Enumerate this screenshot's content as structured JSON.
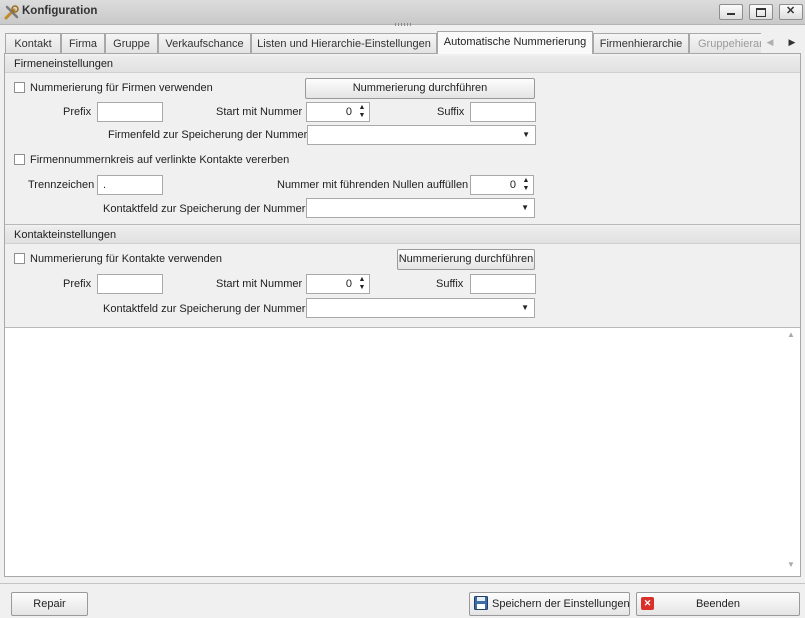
{
  "window": {
    "title": "Konfiguration"
  },
  "tabs": [
    {
      "label": "Kontakt"
    },
    {
      "label": "Firma"
    },
    {
      "label": "Gruppe"
    },
    {
      "label": "Verkaufschance"
    },
    {
      "label": "Listen und Hierarchie-Einstellungen"
    },
    {
      "label": "Automatische Nummerierung"
    },
    {
      "label": "Firmenhierarchie"
    },
    {
      "label": "Gruppehierar"
    }
  ],
  "active_tab": "Automatische Nummerierung",
  "firmen": {
    "header": "Firmeneinstellungen",
    "use_numbering_label": "Nummerierung für Firmen verwenden",
    "use_numbering_checked": false,
    "run_button": "Nummerierung durchführen",
    "prefix_label": "Prefix",
    "prefix_value": "",
    "start_label": "Start mit Nummer",
    "start_value": "0",
    "suffix_label": "Suffix",
    "suffix_value": "",
    "field_label": "Firmenfeld zur Speicherung der Nummer",
    "field_value": "",
    "inherit_label": "Firmennummernkreis auf verlinkte Kontakte vererben",
    "inherit_checked": false,
    "separator_label": "Trennzeichen",
    "separator_value": ".",
    "leading_zeros_label": "Nummer mit führenden Nullen auffüllen",
    "leading_zeros_value": "0",
    "contact_field_label": "Kontaktfeld zur Speicherung der Nummer",
    "contact_field_value": ""
  },
  "kontakte": {
    "header": "Kontakteinstellungen",
    "use_numbering_label": "Nummerierung für Kontakte verwenden",
    "use_numbering_checked": false,
    "run_button": "Nummerierung durchführen",
    "prefix_label": "Prefix",
    "prefix_value": "",
    "start_label": "Start mit Nummer",
    "start_value": "0",
    "suffix_label": "Suffix",
    "suffix_value": "",
    "field_label": "Kontaktfeld zur Speicherung der Nummer",
    "field_value": ""
  },
  "footer": {
    "repair": "Repair",
    "save": "Speichern der Einstellungen",
    "close": "Beenden"
  },
  "icons": {
    "app": "tools-icon",
    "save": "floppy-disk-icon",
    "close": "red-close-icon"
  }
}
